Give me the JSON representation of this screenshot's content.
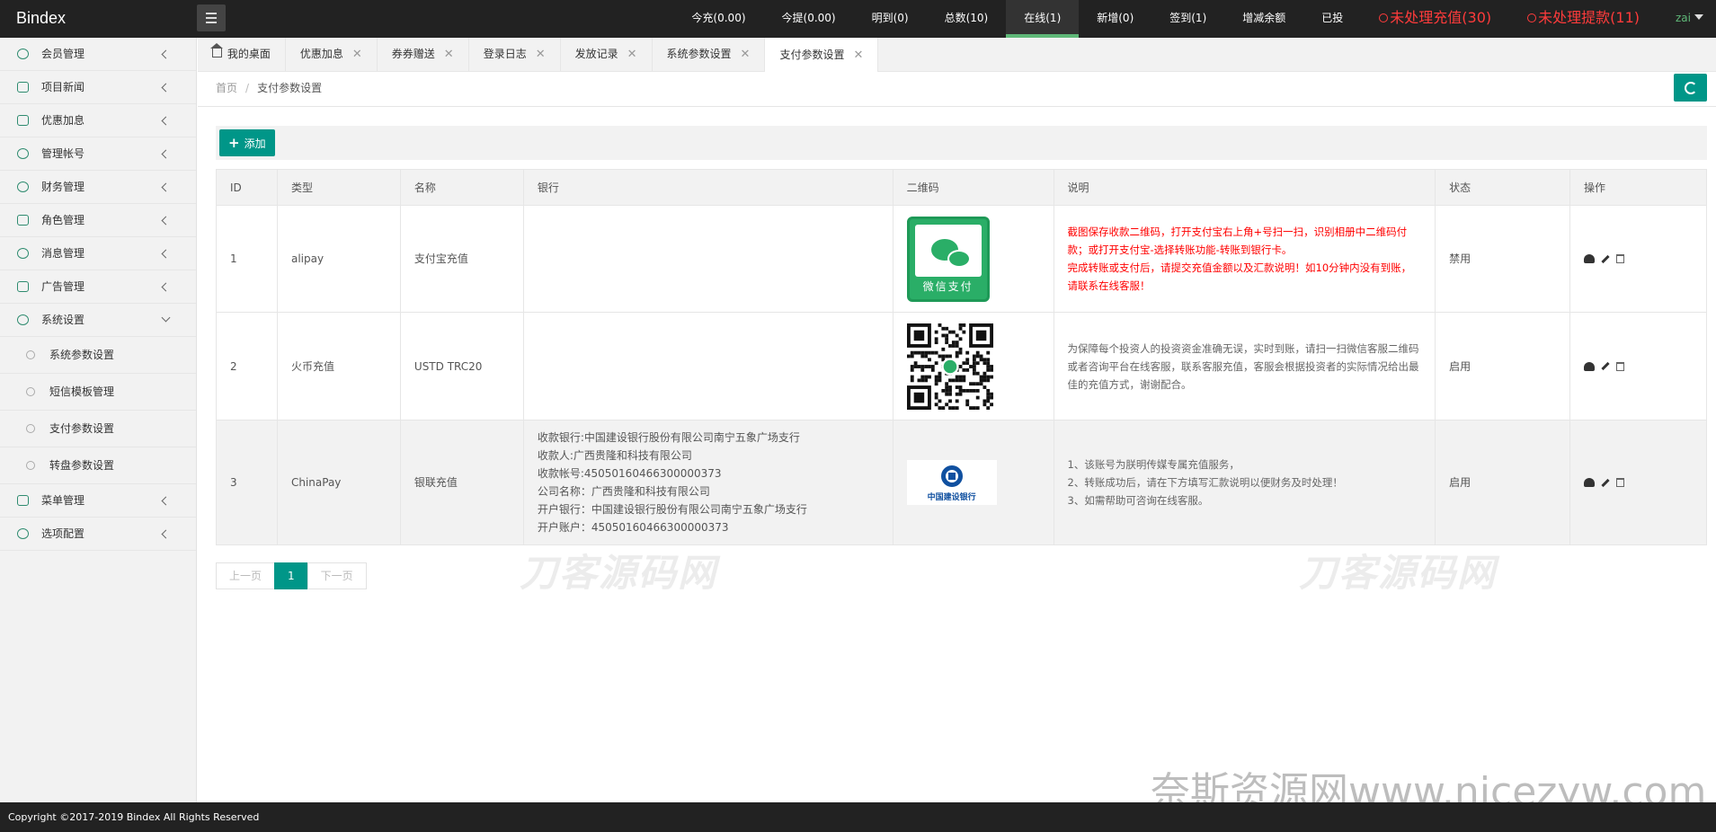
{
  "app": {
    "logo": "Bindex"
  },
  "topnav": {
    "items": [
      {
        "label": "今充(0.00)"
      },
      {
        "label": "今提(0.00)"
      },
      {
        "label": "明到(0)"
      },
      {
        "label": "总数(10)"
      },
      {
        "label": "在线(1)",
        "active": true
      },
      {
        "label": "新增(0)"
      },
      {
        "label": "签到(1)"
      },
      {
        "label": "增减余额"
      },
      {
        "label": "已投"
      }
    ],
    "alerts": [
      {
        "label": "未处理充值(30)"
      },
      {
        "label": "未处理提款(11)"
      }
    ],
    "user": "zai"
  },
  "sidebar": {
    "items": [
      {
        "label": "会员管理"
      },
      {
        "label": "项目新闻"
      },
      {
        "label": "优惠加息"
      },
      {
        "label": "管理帐号"
      },
      {
        "label": "财务管理"
      },
      {
        "label": "角色管理"
      },
      {
        "label": "消息管理"
      },
      {
        "label": "广告管理"
      },
      {
        "label": "系统设置"
      }
    ],
    "sub_items": [
      {
        "label": "系统参数设置"
      },
      {
        "label": "短信模板管理"
      },
      {
        "label": "支付参数设置"
      },
      {
        "label": "转盘参数设置"
      }
    ],
    "items_after": [
      {
        "label": "菜单管理"
      },
      {
        "label": "选项配置"
      }
    ]
  },
  "tabs": [
    {
      "label": "我的桌面"
    },
    {
      "label": "优惠加息"
    },
    {
      "label": "券券赠送"
    },
    {
      "label": "登录日志"
    },
    {
      "label": "发放记录"
    },
    {
      "label": "系统参数设置"
    },
    {
      "label": "支付参数设置",
      "active": true
    }
  ],
  "breadcrumb": {
    "home": "首页",
    "separator": "/",
    "current": "支付参数设置"
  },
  "toolbar": {
    "add_label": "添加"
  },
  "table": {
    "headers": [
      "ID",
      "类型",
      "名称",
      "银行",
      "二维码",
      "说明",
      "状态",
      "操作"
    ],
    "rows": [
      {
        "id": "1",
        "type": "alipay",
        "name": "支付宝充值",
        "bank": [],
        "qr_label": "微信支付",
        "desc": [
          "截图保存收款二维码，打开支付宝右上角+号扫一扫，识别相册中二维码付款；或打开支付宝-选择转账功能-转账到银行卡。",
          "完成转账或支付后，请提交充值金额以及汇款说明！如10分钟内没有到账，请联系在线客服！"
        ],
        "status": "禁用"
      },
      {
        "id": "2",
        "type": "火币充值",
        "name": "USTD TRC20",
        "bank": [],
        "desc": [
          "为保障每个投资人的投资资金准确无误，实时到账，请扫一扫微信客服二维码或者咨询平台在线客服，联系客服充值，客服会根据投资者的实际情况给出最佳的充值方式，谢谢配合。"
        ],
        "status": "启用"
      },
      {
        "id": "3",
        "type": "ChinaPay",
        "name": "银联充值",
        "bank": [
          "收款银行:中国建设银行股份有限公司南宁五象广场支行",
          "收款人:广西贵隆和科技有限公司",
          "收款帐号:45050160466300000373",
          "公司名称：广西贵隆和科技有限公司",
          "开户银行：中国建设银行股份有限公司南宁五象广场支行",
          "开户账户：45050160466300000373"
        ],
        "bank_logo": "中国建设银行",
        "desc": [
          "1、该账号为朕明传媒专属充值服务，",
          "2、转账成功后，请在下方填写汇款说明以便财务及时处理！",
          "3、如需帮助可咨询在线客服。"
        ],
        "status": "启用"
      }
    ]
  },
  "pager": {
    "prev": "上一页",
    "current": "1",
    "next": "下一页"
  },
  "watermarks": {
    "site1": "刀客源码网",
    "site2": "奈斯资源网www.nicezyw.com"
  },
  "footer": {
    "copyright": "Copyright ©2017-2019 Bindex All Rights Reserved"
  },
  "colors": {
    "accent": "#009688",
    "header": "#222222",
    "alert": "#ff3b3b"
  }
}
